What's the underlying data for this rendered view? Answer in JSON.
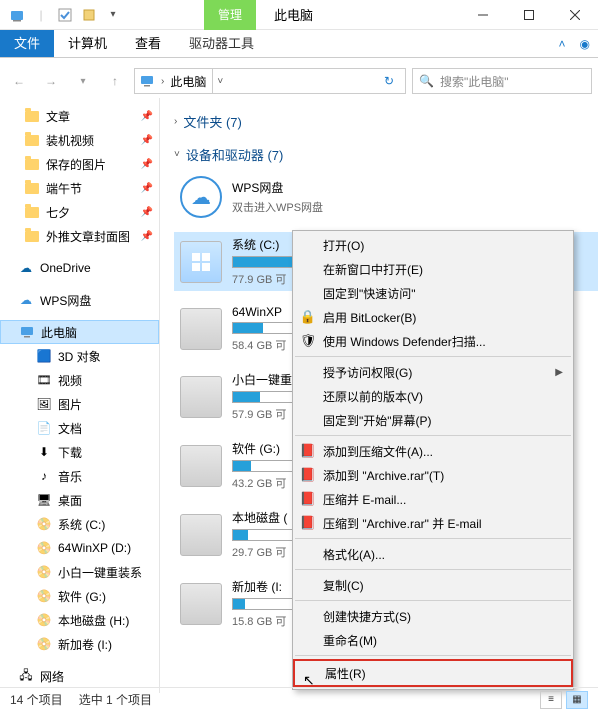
{
  "title_bar": {
    "manage_tab": "管理",
    "title": "此电脑"
  },
  "ribbon": {
    "file": "文件",
    "computer": "计算机",
    "view": "查看",
    "drive_tools": "驱动器工具"
  },
  "address": {
    "crumb": "此电脑",
    "search_placeholder": "搜索\"此电脑\""
  },
  "tree": {
    "items_top": [
      {
        "label": "文章"
      },
      {
        "label": "装机视频"
      },
      {
        "label": "保存的图片"
      },
      {
        "label": "端午节"
      },
      {
        "label": "七夕"
      },
      {
        "label": "外推文章封面图"
      }
    ],
    "onedrive": "OneDrive",
    "wps": "WPS网盘",
    "this_pc": "此电脑",
    "pc_children": [
      {
        "label": "3D 对象"
      },
      {
        "label": "视频"
      },
      {
        "label": "图片"
      },
      {
        "label": "文档"
      },
      {
        "label": "下载"
      },
      {
        "label": "音乐"
      },
      {
        "label": "桌面"
      },
      {
        "label": "系统 (C:)"
      },
      {
        "label": "64WinXP  (D:)"
      },
      {
        "label": "小白一键重装系"
      },
      {
        "label": "软件 (G:)"
      },
      {
        "label": "本地磁盘 (H:)"
      },
      {
        "label": "新加卷 (I:)"
      }
    ],
    "network": "网络"
  },
  "content": {
    "group_folders": "文件夹 (7)",
    "group_devices": "设备和驱动器 (7)",
    "wps": {
      "name": "WPS网盘",
      "sub": "双击进入WPS网盘"
    },
    "drives": [
      {
        "name": "系统 (C:)",
        "sub": "77.9 GB 可",
        "fill": 45,
        "win": true
      },
      {
        "name": "64WinXP",
        "sub": "58.4 GB 可",
        "fill": 20
      },
      {
        "name": "小白一键重",
        "sub": "57.9 GB 可",
        "fill": 18
      },
      {
        "name": "软件 (G:)",
        "sub": "43.2 GB 可",
        "fill": 12
      },
      {
        "name": "本地磁盘 (",
        "sub": "29.7 GB 可",
        "fill": 10
      },
      {
        "name": "新加卷 (I:",
        "sub": "15.8 GB 可",
        "fill": 8
      }
    ]
  },
  "context_menu": {
    "items": [
      {
        "label": "打开(O)"
      },
      {
        "label": "在新窗口中打开(E)"
      },
      {
        "label": "固定到\"快速访问\""
      },
      {
        "label": "启用 BitLocker(B)",
        "icon": "🔒"
      },
      {
        "label": "使用 Windows Defender扫描...",
        "icon": "🛡"
      },
      {
        "sep": true
      },
      {
        "label": "授予访问权限(G)",
        "arrow": true
      },
      {
        "label": "还原以前的版本(V)"
      },
      {
        "label": "固定到\"开始\"屏幕(P)"
      },
      {
        "sep": true
      },
      {
        "label": "添加到压缩文件(A)...",
        "icon": "📕"
      },
      {
        "label": "添加到 \"Archive.rar\"(T)",
        "icon": "📕"
      },
      {
        "label": "压缩并 E-mail...",
        "icon": "📕"
      },
      {
        "label": "压缩到 \"Archive.rar\" 并 E-mail",
        "icon": "📕"
      },
      {
        "sep": true
      },
      {
        "label": "格式化(A)..."
      },
      {
        "sep": true
      },
      {
        "label": "复制(C)"
      },
      {
        "sep": true
      },
      {
        "label": "创建快捷方式(S)"
      },
      {
        "label": "重命名(M)"
      },
      {
        "sep": true
      },
      {
        "label": "属性(R)",
        "highlight": true
      }
    ]
  },
  "status": {
    "left": "14 个项目",
    "mid": "选中 1 个项目"
  }
}
